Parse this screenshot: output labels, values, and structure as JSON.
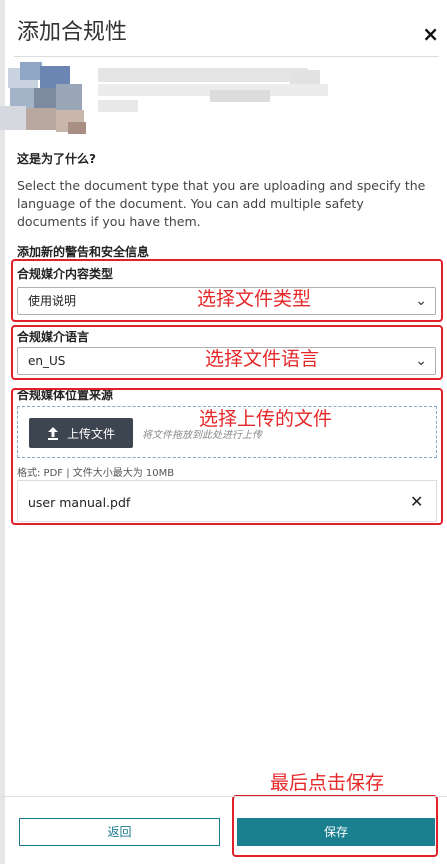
{
  "dialog": {
    "title": "添加合规性",
    "close_symbol": "×"
  },
  "intro": {
    "question": "这是为了什么?",
    "description": "Select the document type that you are uploading and specify the language of the document. You can add multiple safety documents if you have them."
  },
  "form": {
    "add_title": "添加新的警告和安全信息",
    "content_type": {
      "label": "合规媒介内容类型",
      "value": "使用说明"
    },
    "language": {
      "label": "合规媒介语言",
      "value": "en_US"
    },
    "location": {
      "label": "合规媒体位置来源",
      "upload_button": "上传文件",
      "drop_hint": "将文件拖放到此处进行上传",
      "format_note": "格式:  PDF | 文件大小最大为 10MB",
      "file_name": "user manual.pdf"
    }
  },
  "annotations": {
    "select_type": "选择文件类型",
    "select_language": "选择文件语言",
    "select_upload": "选择上传的文件",
    "finally_save": "最后点击保存"
  },
  "footer": {
    "back": "返回",
    "save": "保存"
  },
  "colors": {
    "accent": "#1a7f8e",
    "annotation": "#e0202a"
  }
}
